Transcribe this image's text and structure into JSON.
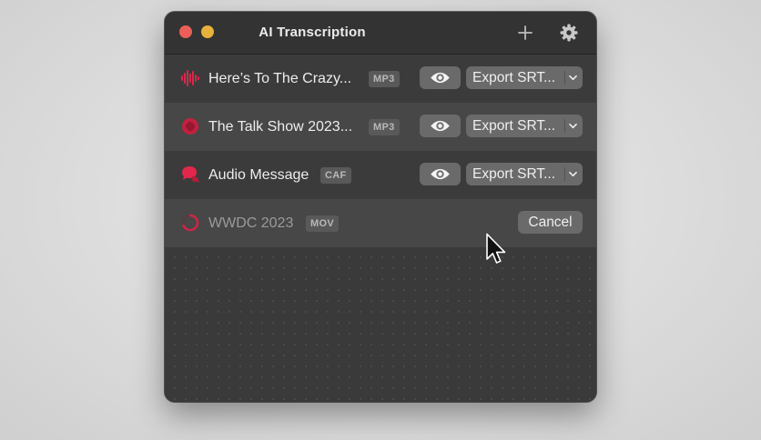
{
  "window": {
    "title": "AI Transcription"
  },
  "toolbar": {
    "add_icon": "plus-icon",
    "settings_icon": "gear-icon"
  },
  "files": [
    {
      "name": "Here’s To The Crazy...",
      "format": "MP3",
      "icon": "waveform-icon",
      "state": "done",
      "export_label": "Export SRT..."
    },
    {
      "name": "The Talk Show 2023...",
      "format": "MP3",
      "icon": "podcast-icon",
      "state": "done",
      "export_label": "Export SRT..."
    },
    {
      "name": "Audio Message",
      "format": "CAF",
      "icon": "speech-bubble-icon",
      "state": "done",
      "export_label": "Export SRT..."
    },
    {
      "name": "WWDC 2023",
      "format": "MOV",
      "icon": "progress-spinner-icon",
      "state": "processing",
      "cancel_label": "Cancel"
    }
  ],
  "colors": {
    "accent": "#e0284d",
    "window_bg": "#3a3a3a",
    "row_alt": "#474747",
    "button": "#6a6a6a"
  }
}
